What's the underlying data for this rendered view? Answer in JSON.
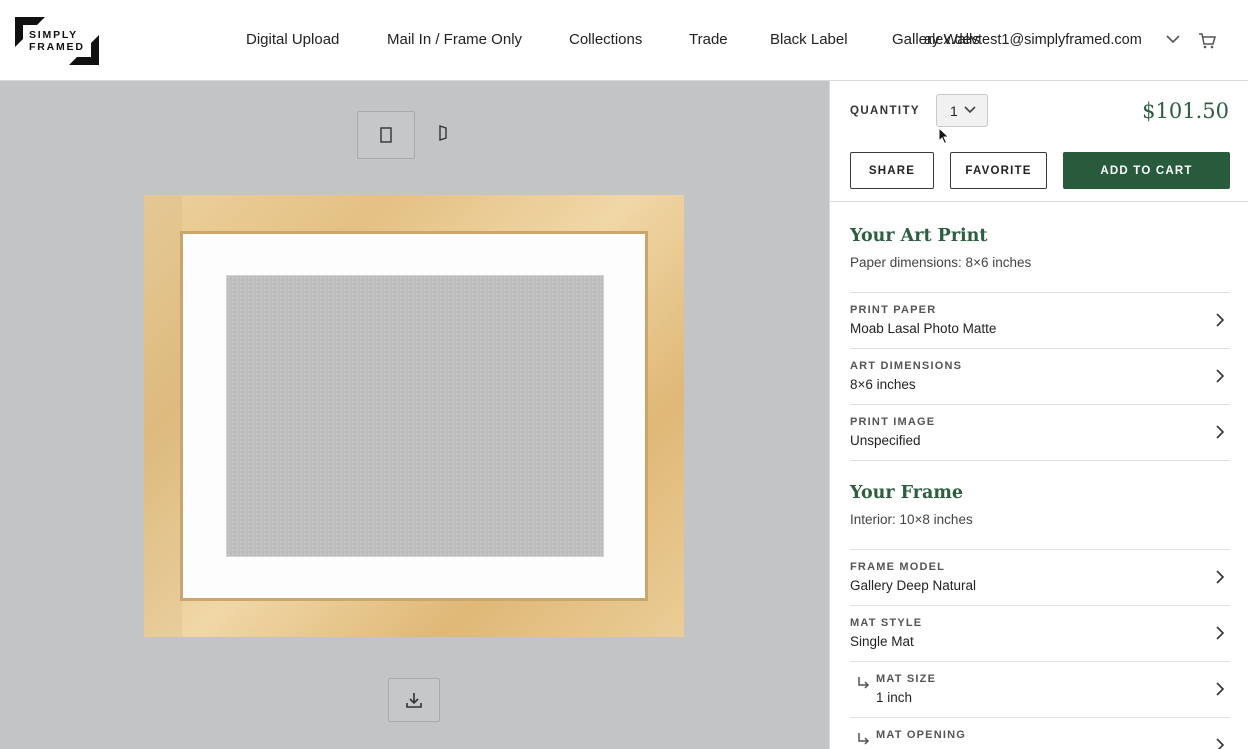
{
  "header": {
    "logo": {
      "line1": "SIMPLY",
      "line2": "FRAMED"
    },
    "nav": [
      {
        "label": "Digital Upload"
      },
      {
        "label": "Mail In / Frame Only"
      },
      {
        "label": "Collections"
      },
      {
        "label": "Trade"
      },
      {
        "label": "Black Label"
      },
      {
        "label": "Gallery Walls"
      }
    ],
    "account_email": "alex.devtest1@simplyframed.com",
    "icons": {
      "account_menu": "chevron-down-icon",
      "cart": "cart-icon"
    }
  },
  "preview": {
    "icons": {
      "view_front": "frame-front-icon",
      "view_angle": "frame-angle-icon",
      "download": "download-icon"
    }
  },
  "panel": {
    "quantity_label": "QUANTITY",
    "quantity_value": "1",
    "price": "$101.50",
    "buttons": {
      "share": "SHARE",
      "favorite": "FAVORITE",
      "add_to_cart": "ADD TO CART"
    },
    "art_print": {
      "title": "Your Art Print",
      "subtitle": "Paper dimensions: 8×6 inches",
      "options": [
        {
          "label": "PRINT PAPER",
          "value": "Moab Lasal Photo Matte"
        },
        {
          "label": "ART DIMENSIONS",
          "value": "8×6 inches"
        },
        {
          "label": "PRINT IMAGE",
          "value": "Unspecified"
        }
      ]
    },
    "frame": {
      "title": "Your Frame",
      "subtitle": "Interior: 10×8 inches",
      "options": [
        {
          "label": "FRAME MODEL",
          "value": "Gallery Deep Natural"
        },
        {
          "label": "MAT STYLE",
          "value": "Single Mat"
        },
        {
          "label": "MAT SIZE",
          "value": "1 inch"
        },
        {
          "label": "MAT OPENING",
          "value": ""
        }
      ]
    }
  },
  "colors": {
    "accent_green": "#275b3c",
    "price_green": "#2c5e3f",
    "preview_bg": "#c3c4c6"
  }
}
